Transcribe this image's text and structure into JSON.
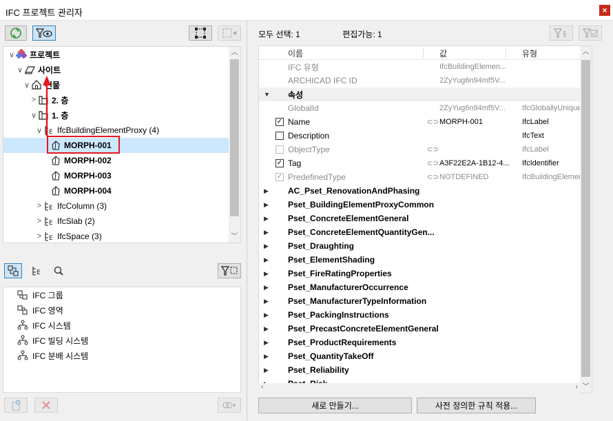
{
  "window": {
    "title": "IFC 프로젝트 관리자",
    "close_glyph": "×"
  },
  "tree": {
    "rows": [
      {
        "label": "프로젝트",
        "bold": true,
        "icon": "project-icon",
        "arrow": "∨"
      },
      {
        "label": "사이트",
        "bold": true,
        "icon": "site-icon",
        "arrow": "∨"
      },
      {
        "label": "건물",
        "bold": true,
        "icon": "building-icon",
        "arrow": "∨"
      },
      {
        "label": "2. 층",
        "bold": true,
        "icon": "storey-icon",
        "arrow": ">"
      },
      {
        "label": "1. 층",
        "bold": true,
        "icon": "storey-icon",
        "arrow": "∨"
      },
      {
        "label": "IfcBuildingElementProxy (4)",
        "bold": false,
        "icon": "type-list-icon",
        "arrow": "∨"
      },
      {
        "label": "MORPH-001",
        "bold": true,
        "icon": "morph-icon",
        "arrow": ""
      },
      {
        "label": "MORPH-002",
        "bold": true,
        "icon": "morph-icon",
        "arrow": ""
      },
      {
        "label": "MORPH-003",
        "bold": true,
        "icon": "morph-icon",
        "arrow": ""
      },
      {
        "label": "MORPH-004",
        "bold": true,
        "icon": "morph-icon",
        "arrow": ""
      },
      {
        "label": "IfcColumn (3)",
        "bold": false,
        "icon": "type-list-icon",
        "arrow": ">"
      },
      {
        "label": "IfcSlab (2)",
        "bold": false,
        "icon": "type-list-icon",
        "arrow": ">"
      },
      {
        "label": "IfcSpace (3)",
        "bold": false,
        "icon": "type-list-icon",
        "arrow": ">"
      }
    ]
  },
  "lower_list": [
    {
      "label": "IFC 그룹",
      "icon": "group-icon"
    },
    {
      "label": "IFC 영역",
      "icon": "zone-icon"
    },
    {
      "label": "IFC 시스템",
      "icon": "system-icon"
    },
    {
      "label": "IFC 빌딩 시스템",
      "icon": "building-system-icon"
    },
    {
      "label": "IFC 분배 시스템",
      "icon": "distribution-system-icon"
    }
  ],
  "right_header": {
    "select_all": "모두 선택: 1",
    "editable": "편집가능: 1"
  },
  "props": {
    "columns": {
      "name": "이름",
      "value": "값",
      "type": "유형"
    },
    "rows": [
      {
        "kind": "attr",
        "name": "IFC 유형",
        "value": "IfcBuildingElemen...",
        "type": "",
        "gray": true
      },
      {
        "kind": "attr",
        "name": "ARCHICAD IFC ID",
        "value": "2ZyYug6n94mf5V...",
        "type": "",
        "gray": true
      },
      {
        "kind": "group",
        "name": "속성",
        "exp": "▼"
      },
      {
        "kind": "attr",
        "name": "GlobalId",
        "value": "2ZyYug6n94mf5V...",
        "type": "IfcGloballyUniqueId",
        "gray": true
      },
      {
        "kind": "attr",
        "name": "Name",
        "value": "MORPH-001",
        "type": "IfcLabel",
        "gray": false,
        "check": "✓",
        "link": "⊂⊃"
      },
      {
        "kind": "attr",
        "name": "Description",
        "value": "",
        "type": "IfcText",
        "gray": false,
        "check": " "
      },
      {
        "kind": "attr",
        "name": "ObjectType",
        "value": "",
        "type": "IfcLabel",
        "gray": true,
        "check": " ",
        "link": "⊂⊃",
        "dis": true
      },
      {
        "kind": "attr",
        "name": "Tag",
        "value": "A3F22E2A-1B12-4...",
        "type": "IfcIdentifier",
        "gray": false,
        "check": "✓",
        "link": "⊂⊃"
      },
      {
        "kind": "attr",
        "name": "PredefinedType",
        "value": "NOTDEFINED",
        "type": "IfcBuildingElementP",
        "gray": true,
        "check": "✓",
        "link": "⊂⊃",
        "dis": true
      },
      {
        "kind": "pset",
        "name": "AC_Pset_RenovationAndPhasing",
        "exp": "▶"
      },
      {
        "kind": "pset",
        "name": "Pset_BuildingElementProxyCommon",
        "exp": "▶"
      },
      {
        "kind": "pset",
        "name": "Pset_ConcreteElementGeneral",
        "exp": "▶"
      },
      {
        "kind": "pset",
        "name": "Pset_ConcreteElementQuantityGen...",
        "exp": "▶"
      },
      {
        "kind": "pset",
        "name": "Pset_Draughting",
        "exp": "▶"
      },
      {
        "kind": "pset",
        "name": "Pset_ElementShading",
        "exp": "▶"
      },
      {
        "kind": "pset",
        "name": "Pset_FireRatingProperties",
        "exp": "▶"
      },
      {
        "kind": "pset",
        "name": "Pset_ManufacturerOccurrence",
        "exp": "▶"
      },
      {
        "kind": "pset",
        "name": "Pset_ManufacturerTypeInformation",
        "exp": "▶"
      },
      {
        "kind": "pset",
        "name": "Pset_PackingInstructions",
        "exp": "▶"
      },
      {
        "kind": "pset",
        "name": "Pset_PrecastConcreteElementGeneral",
        "exp": "▶"
      },
      {
        "kind": "pset",
        "name": "Pset_ProductRequirements",
        "exp": "▶"
      },
      {
        "kind": "pset",
        "name": "Pset_QuantityTakeOff",
        "exp": "▶"
      },
      {
        "kind": "pset",
        "name": "Pset_Reliability",
        "exp": "▶"
      },
      {
        "kind": "pset",
        "name": "Pset_Risk",
        "exp": "▶"
      }
    ]
  },
  "buttons": {
    "new": "새로 만들기...",
    "apply_rules": "사전 정의한 규칙 적용..."
  },
  "colors": {
    "selection": "#cce8ff",
    "annotation_red": "#e8141e",
    "accent": "#3c7fb1"
  }
}
